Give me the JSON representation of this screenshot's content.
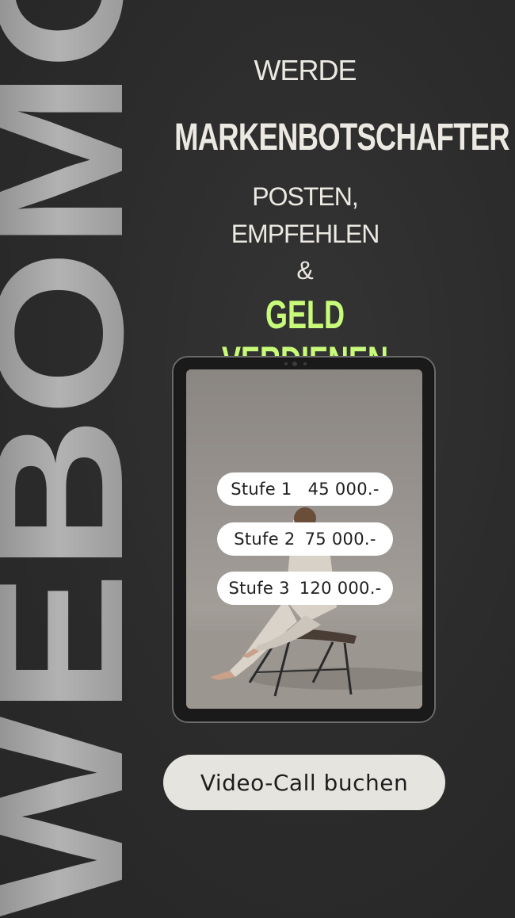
{
  "brand": {
    "vertical_text": "WEBOMO"
  },
  "headline": {
    "line1": "WERDE",
    "line2": "MARKENBOTSCHAFTER",
    "line3": "POSTEN,",
    "line4": "EMPFEHLEN",
    "line5": "&",
    "line6": "GELD VERDIENEN"
  },
  "tiers": [
    {
      "label": "Stufe 1",
      "price": "45 000.-"
    },
    {
      "label": "Stufe 2",
      "price": "75 000.-"
    },
    {
      "label": "Stufe 3",
      "price": "120 000.-"
    }
  ],
  "cta": {
    "label": "Video-Call buchen"
  },
  "colors": {
    "background": "#2b2b2b",
    "headline": "#ece9e2",
    "accent": "#c8fb7a",
    "button": "#e6e4df"
  }
}
